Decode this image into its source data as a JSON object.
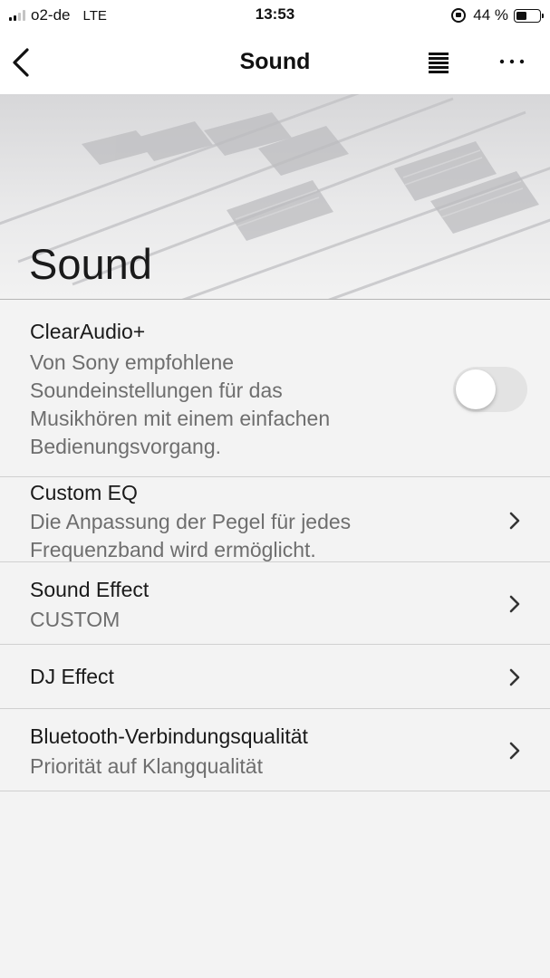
{
  "status_bar": {
    "carrier": "o2-de",
    "network": "LTE",
    "time": "13:53",
    "battery_percent": "44 %",
    "battery_level": 0.44,
    "signal_bars": 2
  },
  "nav": {
    "title": "Sound",
    "icons": [
      "chevron-left-icon",
      "queue-icon",
      "more-icon"
    ]
  },
  "header": {
    "title": "Sound"
  },
  "settings": [
    {
      "title": "ClearAudio+",
      "subtitle_lines": [
        "Von Sony empfohlene",
        "Soundeinstellungen für das",
        "Musikhören mit einem einfachen",
        "Bedienungsvorgang."
      ],
      "control": "toggle",
      "enabled": false
    },
    {
      "title": "Custom EQ",
      "subtitle_lines": [
        "Die Anpassung der Pegel für jedes",
        "Frequenzband wird ermöglicht."
      ],
      "control": "chevron"
    },
    {
      "title": "Sound Effect",
      "subtitle_lines": [
        "CUSTOM"
      ],
      "control": "chevron"
    },
    {
      "title": "DJ Effect",
      "subtitle_lines": [],
      "control": "chevron"
    },
    {
      "title": "Bluetooth-Verbindungsqualität",
      "subtitle_lines": [
        "Priorität auf Klangqualität"
      ],
      "control": "chevron"
    }
  ],
  "colors": {
    "background": "#f3f3f3",
    "text_primary": "#1a1a1a",
    "text_secondary": "#6e6e6e",
    "divider": "#d0d0d0",
    "toggle_off": "#e3e3e3"
  }
}
